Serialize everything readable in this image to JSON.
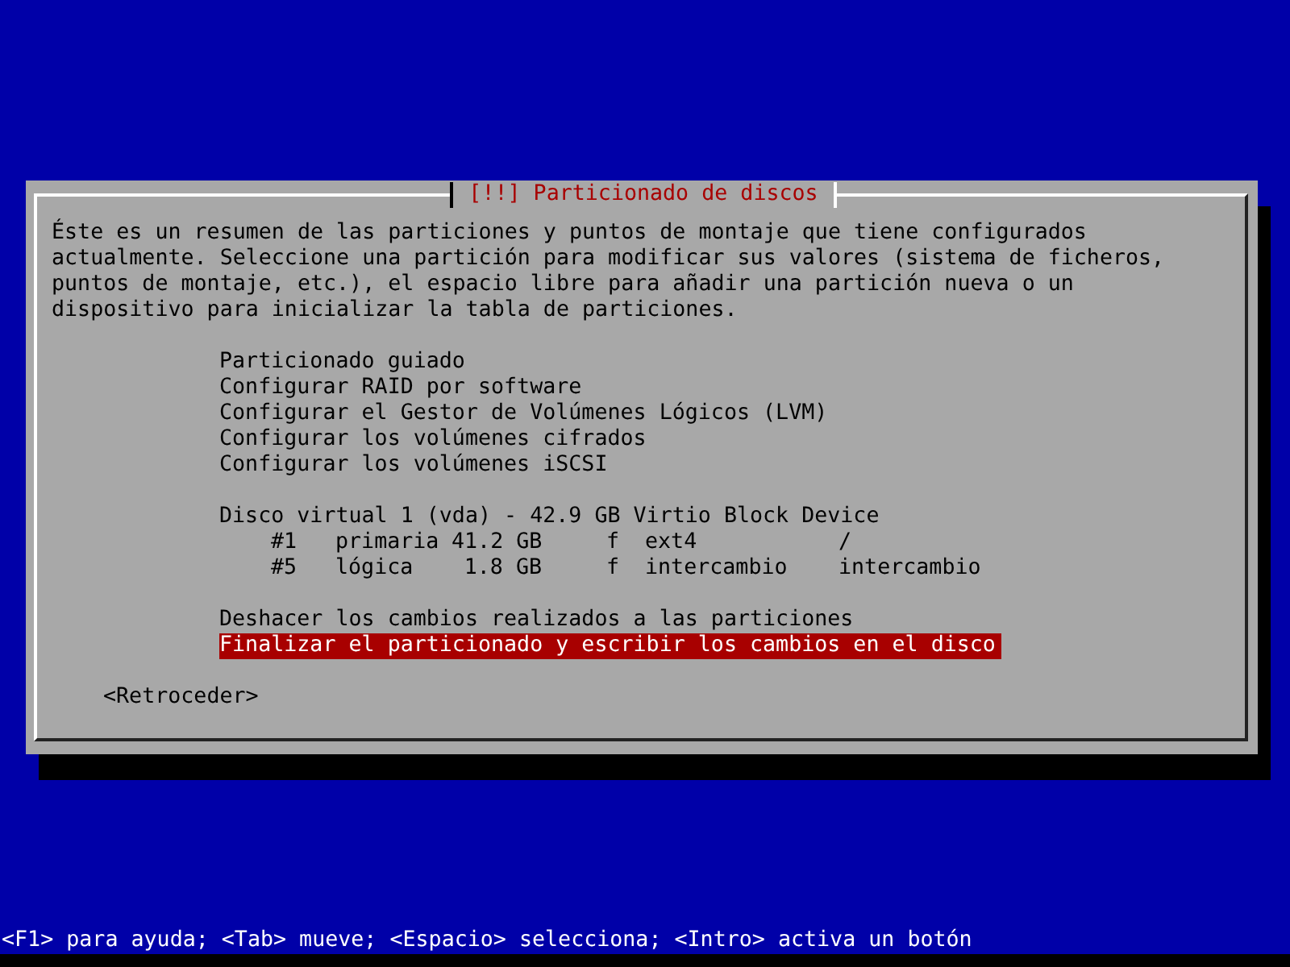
{
  "dialog": {
    "title": "[!!] Particionado de discos",
    "description": "Éste es un resumen de las particiones y puntos de montaje que tiene configurados actualmente. Seleccione una partición para modificar sus valores (sistema de ficheros, puntos de montaje, etc.), el espacio libre para añadir una partición nueva o un dispositivo para inicializar la tabla de particiones.",
    "actions": [
      {
        "label": "Particionado guiado",
        "selected": false
      },
      {
        "label": "Configurar RAID por software",
        "selected": false
      },
      {
        "label": "Configurar el Gestor de Volúmenes Lógicos (LVM)",
        "selected": false
      },
      {
        "label": "Configurar los volúmenes cifrados",
        "selected": false
      },
      {
        "label": "Configurar los volúmenes iSCSI",
        "selected": false
      }
    ],
    "disk": {
      "label": "Disco virtual 1 (vda) - 42.9 GB Virtio Block Device",
      "selected": false,
      "partitions": [
        {
          "number": "#1",
          "type": "primaria",
          "size": "41.2 GB",
          "flag": "f",
          "filesystem": "ext4",
          "mount": "/",
          "selected": false
        },
        {
          "number": "#5",
          "type": "lógica",
          "size": "1.8 GB",
          "flag": "f",
          "filesystem": "intercambio",
          "mount": "intercambio",
          "selected": false
        }
      ]
    },
    "final_actions": [
      {
        "label": "Deshacer los cambios realizados a las particiones",
        "selected": false
      },
      {
        "label": "Finalizar el particionado y escribir los cambios en el disco",
        "selected": true
      }
    ],
    "back_button": "<Retroceder>"
  },
  "status_bar": "<F1> para ayuda; <Tab> mueve; <Espacio> selecciona; <Intro> activa un botón"
}
